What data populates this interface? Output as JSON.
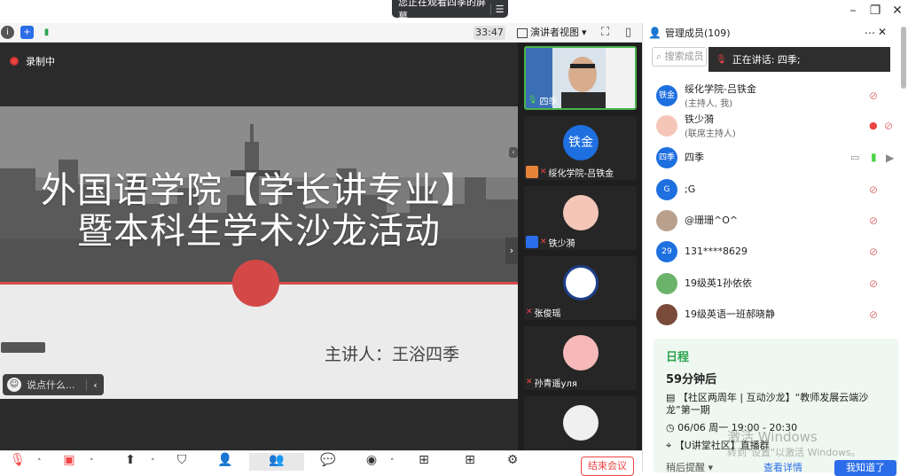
{
  "window": {
    "sharing_banner": "您正在观看四季的屏幕",
    "controls": [
      "minimize-icon",
      "restore-icon",
      "close-icon"
    ]
  },
  "infobar": {
    "timer": "33:47",
    "view_mode": "演讲者视图"
  },
  "stage": {
    "recording_label": "录制中",
    "slide": {
      "title_line1": "外国语学院【学长讲专业】",
      "title_line2": "暨本科生学术沙龙活动",
      "speaker": "主讲人：王浴四季"
    },
    "chat_placeholder": "说点什么..."
  },
  "tiles": [
    {
      "name": "四季",
      "type": "video",
      "active": true
    },
    {
      "name": "绥化学院-吕铁金",
      "avatar_text": "铁金",
      "avatar_color": "#1e6fe0"
    },
    {
      "name": "铁少漪",
      "avatar_text": "",
      "avatar_color": "#f3c6b8"
    },
    {
      "name": "张俊瑶",
      "avatar_text": "",
      "avatar_color": "#ffffff"
    },
    {
      "name": "孙青遥уля",
      "avatar_text": "",
      "avatar_color": "#f6b8b8"
    },
    {
      "name": "",
      "avatar_text": "",
      "avatar_color": "#f0f0f0"
    }
  ],
  "panel": {
    "title": "管理成员(109)",
    "search_placeholder": "搜索成员",
    "now_speaking": "正在讲话: 四季;",
    "members": [
      {
        "name": "绥化学院-吕铁金",
        "sub": "(主持人, 我)",
        "avatar_text": "铁金",
        "avatar_color": "#1e6fe0"
      },
      {
        "name": "铁少漪",
        "sub": "(联席主持人)",
        "avatar_text": "",
        "avatar_color": "#f3c6b8"
      },
      {
        "name": "四季",
        "sub": "",
        "avatar_text": "四季",
        "avatar_color": "#1e6fe0"
      },
      {
        "name": ";G",
        "sub": "",
        "avatar_text": "G",
        "avatar_color": "#1e6fe0"
      },
      {
        "name": "@珊珊^O^",
        "sub": "",
        "avatar_text": "",
        "avatar_color": "#b9a08c"
      },
      {
        "name": "131****8629",
        "sub": "",
        "avatar_text": "29",
        "avatar_color": "#1e6fe0"
      },
      {
        "name": "19级英1孙依依",
        "sub": "",
        "avatar_text": "",
        "avatar_color": "#6bb26b"
      },
      {
        "name": "19级英语一班郝晓静",
        "sub": "",
        "avatar_text": "",
        "avatar_color": "#7a4b3a"
      }
    ],
    "schedule": {
      "title": "日程",
      "countdown": "59分钟后",
      "event": "【社区两周年 | 互动沙龙】“教师发展云端沙龙”第一期",
      "time": "06/06 周一 19:00 - 20:30",
      "location": "【U讲堂社区】直播群",
      "remind_later": "稍后提醒",
      "view_details": "查看详情",
      "got_it": "我知道了"
    }
  },
  "watermark": {
    "line1": "激活 Windows",
    "line2": "转到\"设置\"以激活 Windows。"
  },
  "toolbar": {
    "end_meeting": "结束会议",
    "buttons": [
      "mic-icon",
      "camera-icon",
      "share-screen-icon",
      "security-icon",
      "invite-icon",
      "members-icon",
      "chat-icon",
      "record-icon",
      "layout-icon",
      "apps-icon",
      "settings-icon"
    ]
  },
  "colors": {
    "accent": "#1e6fe0",
    "green": "#2da44e",
    "red": "#e44444"
  }
}
